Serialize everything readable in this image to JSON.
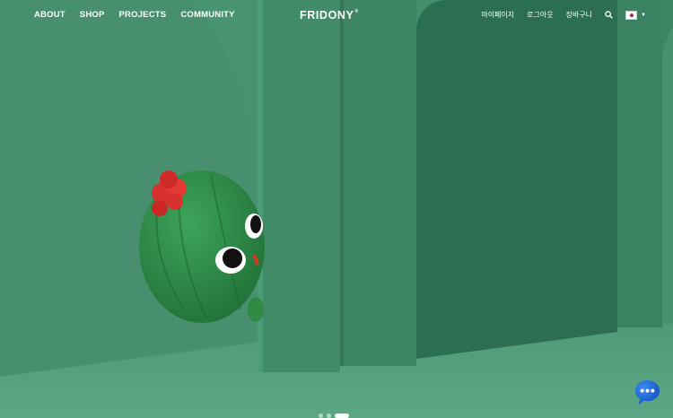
{
  "nav": {
    "left": [
      {
        "label": "ABOUT",
        "name": "nav-about"
      },
      {
        "label": "SHOP",
        "name": "nav-shop"
      },
      {
        "label": "PROJECTS",
        "name": "nav-projects"
      },
      {
        "label": "COMMUNITY",
        "name": "nav-community"
      }
    ],
    "logo": "FRIDONY",
    "logo_mark": "®",
    "right": {
      "mypage": "마이페이지",
      "logout": "로그아웃",
      "cart": "장바구니"
    }
  },
  "icons": {
    "search": "search-icon",
    "language": "korea-flag-icon",
    "dropdown": "caret-down-icon",
    "chat": "chat-bubble-icon"
  },
  "slider": {
    "count": 3,
    "active_index": 2
  },
  "colors": {
    "wall": "#3f8f6c",
    "floor": "#5aa27f",
    "pillar": "#2e7659",
    "character": "#2f8a45",
    "flower": "#d8302c",
    "chat": "#1565d8"
  }
}
